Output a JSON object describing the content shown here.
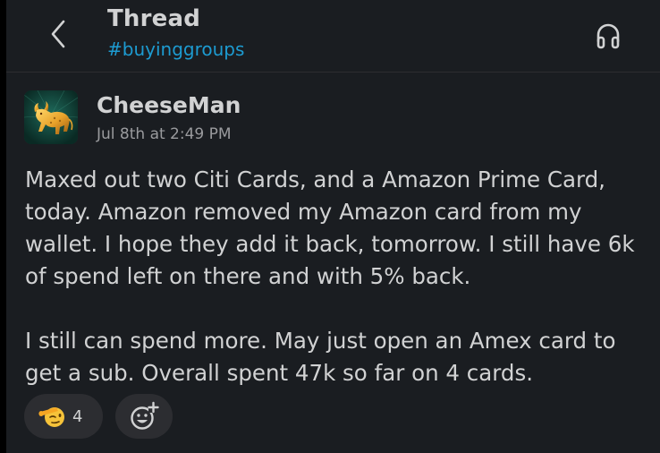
{
  "header": {
    "title": "Thread",
    "channel": "#buyinggroups",
    "back_icon": "chevron-left-icon",
    "huddle_icon": "headphones-icon"
  },
  "message": {
    "author": "CheeseMan",
    "timestamp": "Jul 8th at 2:49 PM",
    "avatar_icon": "golden-bull-avatar",
    "paragraphs": [
      "Maxed out two Citi Cards, and a Amazon Prime Card, today. Amazon removed my Amazon card from my wallet. I hope they add it back, tomorrow. I still have 6k of spend left on there and with 5% back.",
      "I still can spend more. May just open an Amex card to get a sub. Overall spent 47k so far on 4 cards."
    ]
  },
  "reactions": [
    {
      "emoji": "saluting-face-icon",
      "count": "4"
    }
  ],
  "add_reaction_icon": "add-reaction-icon",
  "colors": {
    "background": "#1a1d21",
    "text": "#d1d2d3",
    "channel_link": "#1d9bd1",
    "muted": "#9a9b9e",
    "reaction_bg": "#2c2d31"
  }
}
